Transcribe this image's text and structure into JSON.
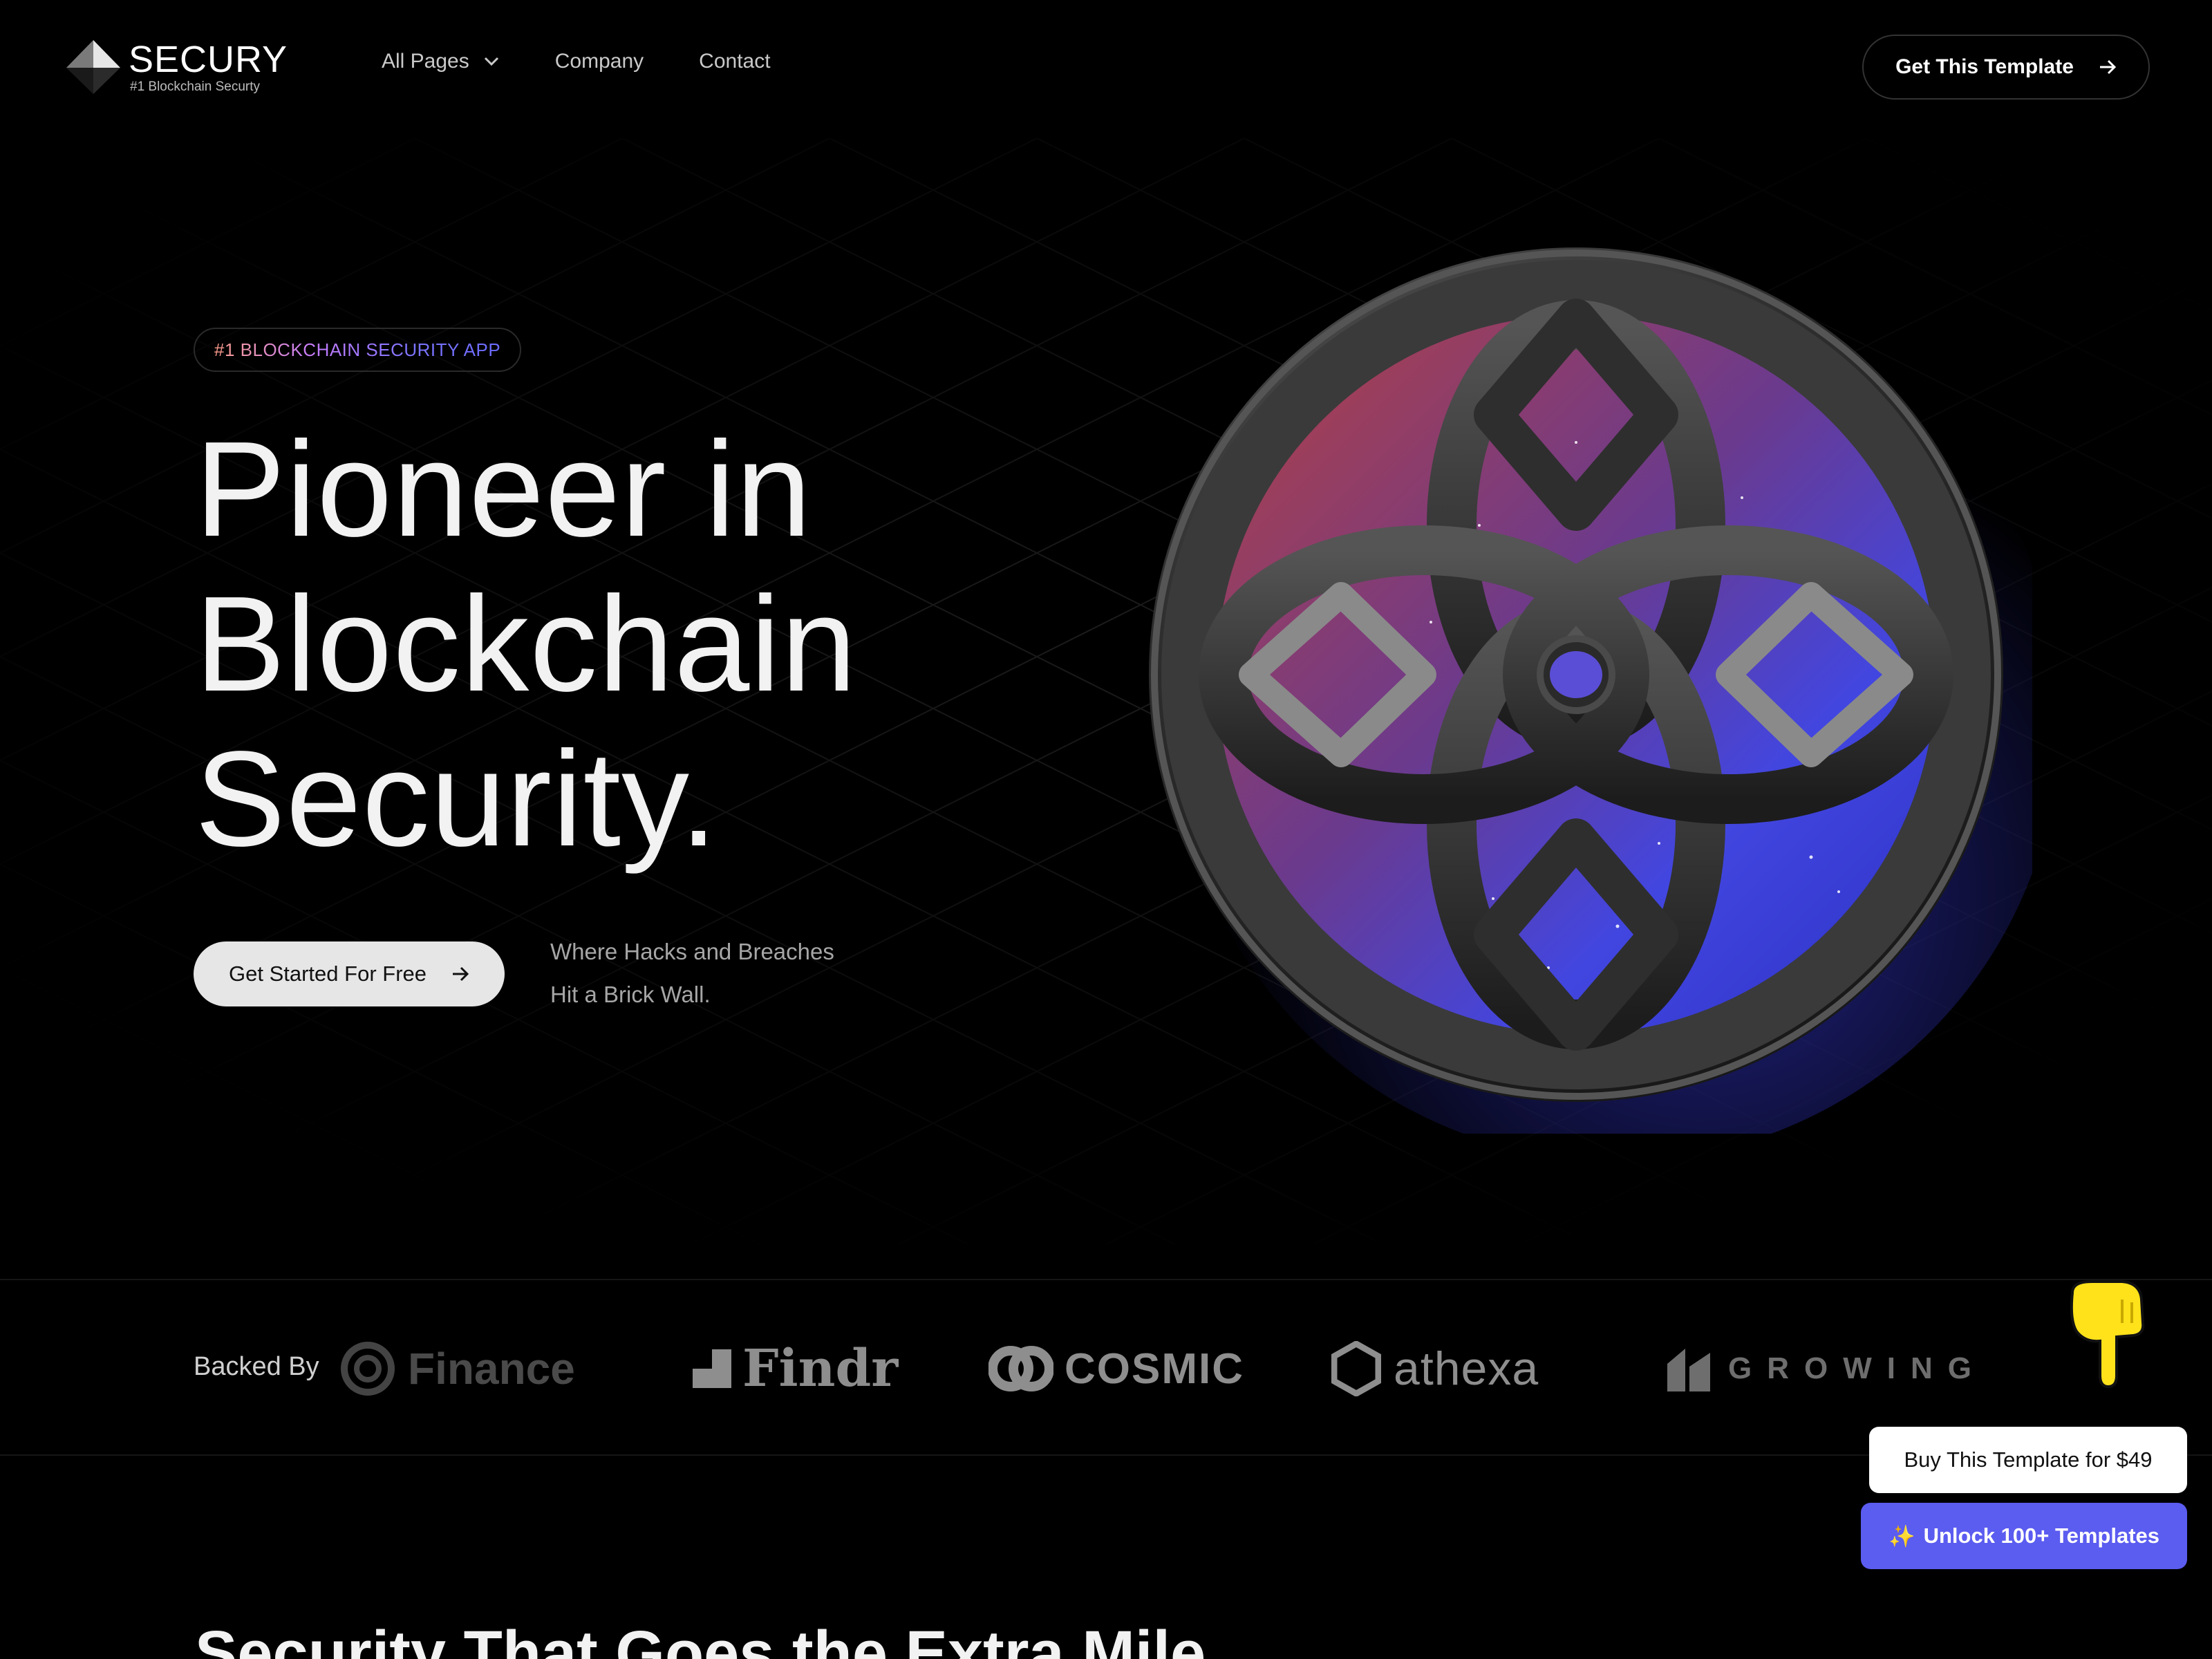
{
  "nav": {
    "logo": {
      "name": "SECURY",
      "tagline": "#1 Blockchain Securty"
    },
    "links": [
      {
        "label": "All Pages",
        "icon": "chevron-down-icon"
      },
      {
        "label": "Company"
      },
      {
        "label": "Contact"
      }
    ],
    "cta": {
      "label": "Get This Template",
      "icon": "arrow-right-icon"
    }
  },
  "hero": {
    "badge": "#1 BLOCKCHAIN SECURITY APP",
    "title_lines": [
      "Pioneer in",
      "Blockchain",
      "Security."
    ],
    "button": {
      "label": "Get Started For Free",
      "icon": "arrow-right-icon"
    },
    "subtitle_lines": [
      "Where Hacks and Breaches",
      "Hit a Brick Wall."
    ]
  },
  "backers": {
    "label": "Backed By",
    "brands": [
      "Finance",
      "Findr",
      "COSMIC",
      "athexa",
      "GROWING"
    ]
  },
  "floating": {
    "buy_label": "Buy This Template for $49",
    "unlock_label": "Unlock 100+ Templates",
    "unlock_icon": "sparkles-icon",
    "pointer_icon": "hand-pointing-down-icon"
  },
  "section": {
    "title": "Security That Goes the Extra Mile"
  },
  "colors": {
    "background": "#000000",
    "accent": "#5b5cf0",
    "orb_red": "#c94b4b",
    "orb_blue": "#4b4fe8"
  }
}
